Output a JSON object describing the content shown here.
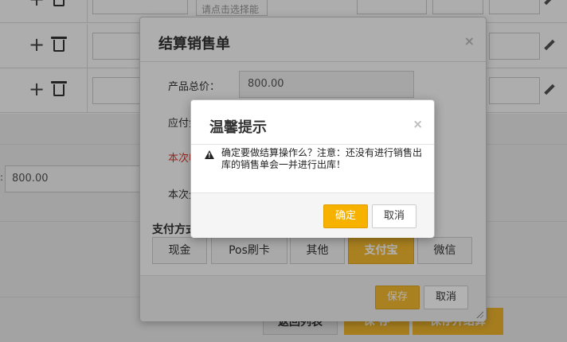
{
  "background": {
    "select_placeholder": "请点击选择能",
    "price_value": "800.00",
    "price_colon": ":",
    "buttons": {
      "back_list": "返回列表",
      "save": "保 存",
      "save_and_settle": "保存并结算"
    }
  },
  "settle_modal": {
    "title": "结算销售单",
    "close_symbol": "×",
    "total_price_label": "产品总价：",
    "total_price_value": "800.00",
    "payable_label": "应付金",
    "this_receipt_label": "本次收",
    "this_payment_label": "本次欠",
    "pay_method_label": "支付方式",
    "pay_methods": [
      {
        "label": "现金",
        "active": false
      },
      {
        "label": "Pos刷卡",
        "active": false
      },
      {
        "label": "其他",
        "active": false
      },
      {
        "label": "支付宝",
        "active": true
      },
      {
        "label": "微信",
        "active": false
      }
    ],
    "save_label": "保存",
    "cancel_label": "取消"
  },
  "alert": {
    "title": "温馨提示",
    "close_symbol": "×",
    "message": "确定要做结算操作么？注意：还没有进行销售出库的销售单会一并进行出库！",
    "ok_label": "确定",
    "cancel_label": "取消"
  },
  "colors": {
    "accent": "#f4b92f",
    "alert_ok": "#f7b200",
    "warning_text": "#d9342b"
  }
}
